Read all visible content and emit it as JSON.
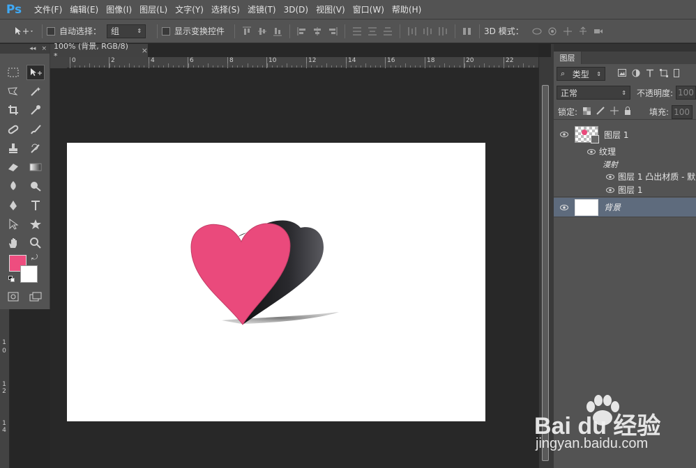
{
  "app": {
    "logo": "Ps",
    "menu": [
      "文件(F)",
      "编辑(E)",
      "图像(I)",
      "图层(L)",
      "文字(Y)",
      "选择(S)",
      "滤镜(T)",
      "3D(D)",
      "视图(V)",
      "窗口(W)",
      "帮助(H)"
    ]
  },
  "options_bar": {
    "auto_select_label": "自动选择：",
    "auto_select_value": "组",
    "show_transform_label": "显示变换控件",
    "mode_3d_label": "3D 模式："
  },
  "document": {
    "tab_title": "100% (背景, RGB/8) *",
    "close": "×"
  },
  "toolbox": {
    "header_collapse": "◂◂",
    "header_close": "×"
  },
  "ruler": {
    "h_labels": [
      "0",
      "2",
      "4",
      "6",
      "8",
      "10",
      "12",
      "14",
      "16",
      "18",
      "20",
      "22"
    ],
    "v_labels": [
      "1",
      "0",
      "1",
      "2",
      "1",
      "4"
    ]
  },
  "layers_panel": {
    "tab_label": "图层",
    "filter_kind": "类型",
    "blend_mode": "正常",
    "opacity_label": "不透明度:",
    "opacity_value": "100",
    "lock_label": "锁定:",
    "fill_label": "填充:",
    "fill_value": "100",
    "layers": [
      {
        "name": "图层 1",
        "type": "3d"
      },
      {
        "name": "纹理",
        "type": "sub"
      },
      {
        "name": "漫射",
        "type": "subgroup"
      },
      {
        "name": "图层 1 凸出材质 - 默",
        "type": "texture"
      },
      {
        "name": "图层 1",
        "type": "texture"
      },
      {
        "name": "背景",
        "type": "background"
      }
    ]
  },
  "watermark": {
    "brand": "Bai du 经验",
    "url": "jingyan.baidu.com"
  },
  "colors": {
    "foreground": "#ee4d7f",
    "background": "#ffffff",
    "heart_front": "#ea4a7c",
    "heart_side": "#1a1a1c"
  }
}
